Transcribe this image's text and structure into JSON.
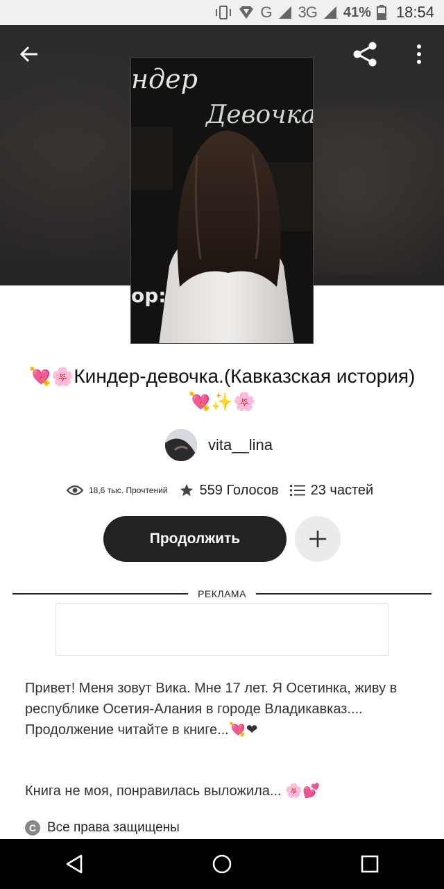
{
  "status_bar": {
    "network_g": "G",
    "network_3g": "3G",
    "battery": "41%",
    "time": "18:54"
  },
  "header": {
    "back_icon": "arrow-left-icon",
    "share_icon": "share-icon",
    "more_icon": "more-vertical-icon"
  },
  "cover": {
    "text_top": "ндер",
    "text_mid": "Девочка",
    "text_bottom": "op:"
  },
  "story": {
    "title_emoji_start": "💘🌸",
    "title_text": "Киндер-девочка.(Кавказская история)",
    "title_emoji_end": "💘✨🌸",
    "author": "vita__lina"
  },
  "stats": {
    "reads": "18,6 тыс. Прочтений",
    "votes": "559 Голосов",
    "parts": "23 частей"
  },
  "actions": {
    "continue_label": "Продолжить",
    "add_icon": "plus-icon"
  },
  "ad": {
    "label": "РЕКЛАМА"
  },
  "description": {
    "paragraph1": "Привет! Меня зовут Вика. Мне 17 лет. Я Осетинка, живу в республике Осетия-Алания в городе Владикавказ.... Продолжение читайте в книге...💘❤",
    "paragraph2": "Книга не моя,  понравилась выложила... 🌸💕"
  },
  "rights": {
    "label": "Все права защищены"
  },
  "colors": {
    "button_dark": "#222222",
    "header_bg": "#2b2a2a",
    "add_button_bg": "#ebebeb"
  }
}
